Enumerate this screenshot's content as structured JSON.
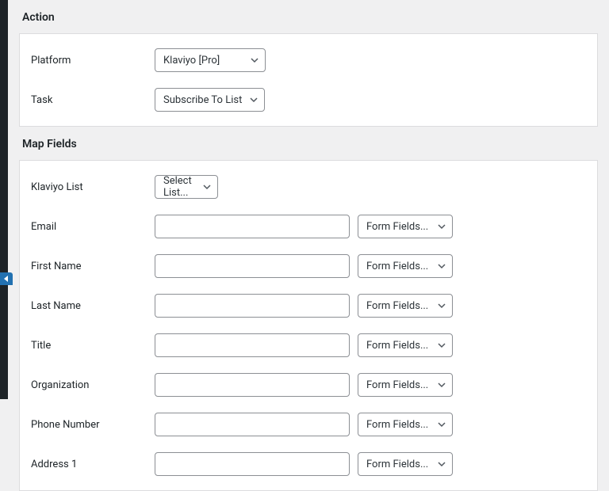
{
  "sections": {
    "action": {
      "heading": "Action"
    },
    "map_fields": {
      "heading": "Map Fields"
    }
  },
  "action": {
    "platform": {
      "label": "Platform",
      "value": "Klaviyo [Pro]"
    },
    "task": {
      "label": "Task",
      "value": "Subscribe To List"
    }
  },
  "map": {
    "klaviyo_list": {
      "label": "Klaviyo List",
      "value": "Select List..."
    },
    "form_fields_label": "Form Fields...",
    "rows": [
      {
        "key": "email",
        "label": "Email",
        "value": ""
      },
      {
        "key": "first_name",
        "label": "First Name",
        "value": ""
      },
      {
        "key": "last_name",
        "label": "Last Name",
        "value": ""
      },
      {
        "key": "title",
        "label": "Title",
        "value": ""
      },
      {
        "key": "organization",
        "label": "Organization",
        "value": ""
      },
      {
        "key": "phone_number",
        "label": "Phone Number",
        "value": ""
      },
      {
        "key": "address_1",
        "label": "Address 1",
        "value": ""
      }
    ]
  }
}
